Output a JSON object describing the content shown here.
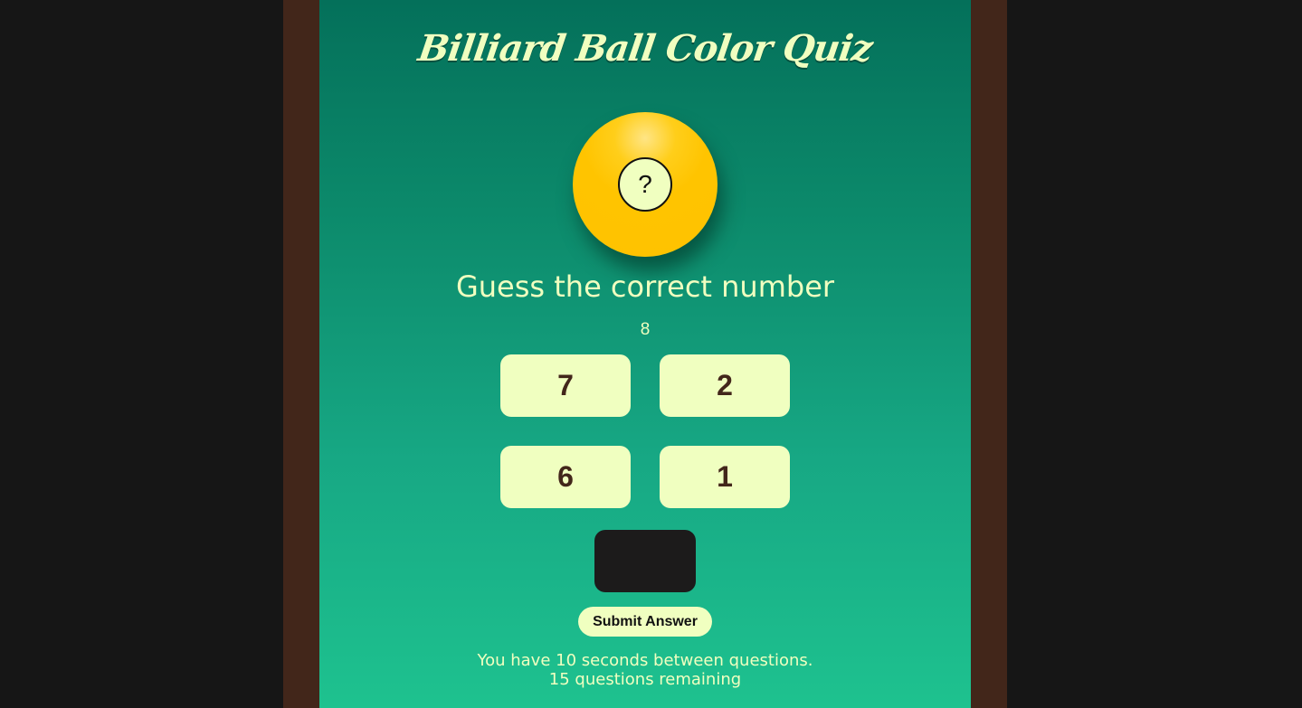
{
  "quiz": {
    "title": "Billiard Ball Color Quiz",
    "ball": {
      "symbol": "?",
      "color": "#ffc400"
    },
    "prompt": "Guess the correct number",
    "displayed_value": "8",
    "choices": [
      "7",
      "2",
      "6",
      "1"
    ],
    "answer_value": "",
    "submit_label": "Submit Answer",
    "timer_text": "You have 10 seconds between questions.",
    "remaining_text": "15 questions remaining"
  },
  "colors": {
    "page_background": "#161616",
    "frame_wood": "#42261a",
    "felt_top": "#04705a",
    "felt_bottom": "#1ec28f",
    "text_cream": "#f0ffc0",
    "ball_yellow": "#ffc400",
    "answer_box": "#1c1b1b"
  }
}
